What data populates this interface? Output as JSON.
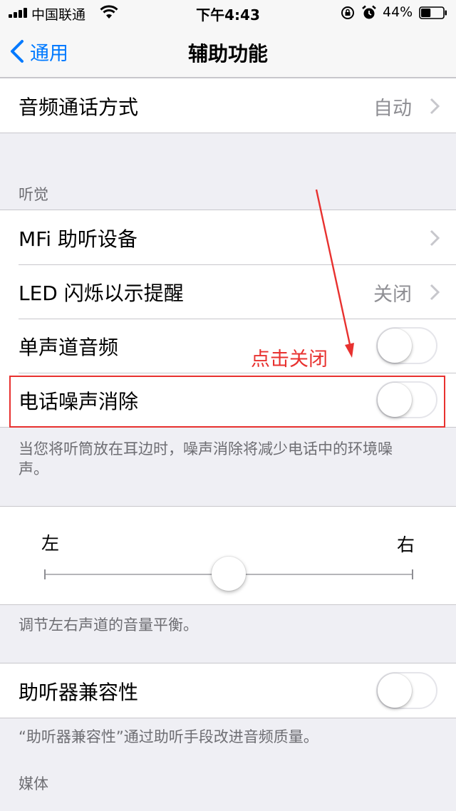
{
  "status_bar": {
    "carrier": "中国联通",
    "time": "下午4:43",
    "battery_percent": "44%",
    "battery_level": 0.44
  },
  "nav": {
    "back_label": "通用",
    "title": "辅助功能"
  },
  "rows": {
    "audio_routing": {
      "label": "音频通话方式",
      "value": "自动"
    },
    "hearing_header": "听觉",
    "mfi": {
      "label": "MFi 助听设备"
    },
    "led_flash": {
      "label": "LED 闪烁以示提醒",
      "value": "关闭"
    },
    "mono_audio": {
      "label": "单声道音频",
      "on": false
    },
    "noise_cancel": {
      "label": "电话噪声消除",
      "on": false
    },
    "noise_footer": "当您将听筒放在耳边时，噪声消除将减少电话中的环境噪声。",
    "balance": {
      "left": "左",
      "right": "右",
      "value": 0.5
    },
    "balance_footer": "调节左右声道的音量平衡。",
    "hearing_aid": {
      "label": "助听器兼容性",
      "on": false
    },
    "hearing_aid_footer": "“助听器兼容性”通过助听手段改进音频质量。",
    "media_header": "媒体"
  },
  "annotation": {
    "text": "点击关闭",
    "color": "#e8312f"
  },
  "colors": {
    "accent": "#007aff",
    "background": "#efeff4",
    "secondary_text": "#8e8e93"
  }
}
